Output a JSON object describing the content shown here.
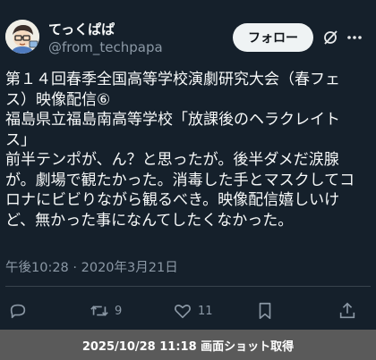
{
  "author": {
    "display_name": "てっくぱぱ",
    "handle": "@from_techpapa",
    "avatar_icon": "cartoon-avatar-icon"
  },
  "header_actions": {
    "follow_label": "フォロー",
    "grok_icon": "grok-icon",
    "more_icon": "more-icon"
  },
  "tweet": {
    "lines": [
      "第１４回春季全国高等学校演劇研究大会（春フェ",
      "ス）映像配信⑥",
      "福島県立福島南高等学校「放課後のヘラクレイト",
      "ス」",
      "前半テンポが、ん？と思ったが。後半ダメだ涙腺",
      "が。劇場で観たかった。消毒した手とマスクしてコ",
      "ロナにビビりながら観るべき。映像配信嬉しいけ",
      "ど、無かった事になんてしたくなかった。"
    ],
    "timestamp": "午後10:28 · 2020年3月21日"
  },
  "actions": {
    "reply_icon": "reply-icon",
    "retweet_icon": "retweet-icon",
    "retweet_count": "9",
    "like_icon": "like-icon",
    "like_count": "11",
    "bookmark_icon": "bookmark-icon",
    "share_icon": "share-icon"
  },
  "footer": {
    "caption": "2025/10/28 11:18 画面ショット取得"
  }
}
